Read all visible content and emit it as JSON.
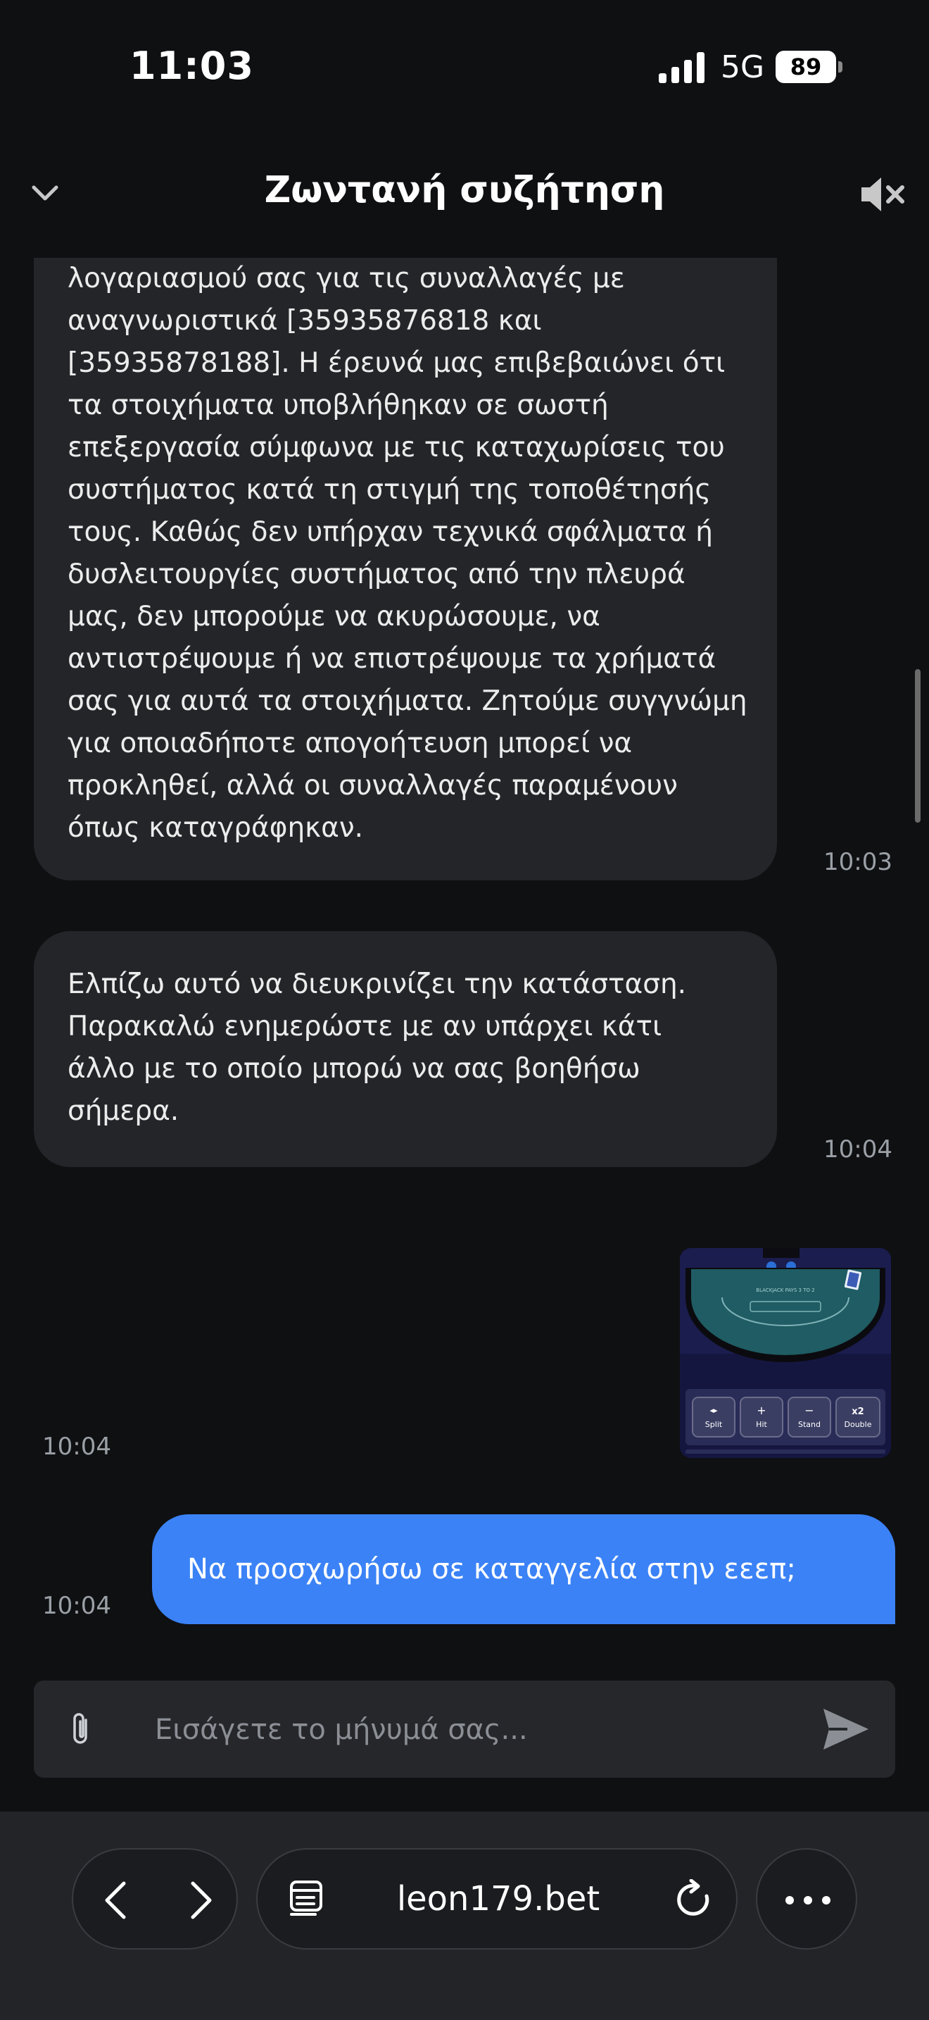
{
  "status_bar": {
    "time": "11:03",
    "network": "5G",
    "battery": "89"
  },
  "header": {
    "title": "Ζωντανή συζήτηση"
  },
  "messages": {
    "m1_lines": [
      "λογαριασμού σας για τις συναλλαγές με",
      "αναγνωριστικά [35935876818 και",
      "[35935878188]. Η έρευνά μας επιβεβαιώνει ότι",
      "τα στοιχήματα υποβλήθηκαν σε σωστή",
      "επεξεργασία σύμφωνα με τις καταχωρίσεις του",
      "συστήματος κατά τη στιγμή της τοποθέτησής",
      "τους. Καθώς δεν υπήρχαν τεχνικά σφάλματα ή",
      "δυσλειτουργίες συστήματος από την πλευρά",
      "μας, δεν μπορούμε να ακυρώσουμε, να",
      "αντιστρέψουμε ή να επιστρέψουμε τα χρήματά",
      "σας για αυτά τα στοιχήματα. Ζητούμε συγγνώμη",
      "για οποιαδήποτε απογοήτευση μπορεί να",
      "προκληθεί, αλλά οι συναλλαγές παραμένουν",
      "όπως καταγράφηκαν."
    ],
    "m1_time": "10:03",
    "m2_lines": [
      "Ελπίζω αυτό να διευκρινίζει την κατάσταση.",
      "Παρακαλώ ενημερώστε με αν υπάρχει κάτι",
      "άλλο με το οποίο μπορώ να σας βοηθήσω",
      "σήμερα."
    ],
    "m2_time": "10:04",
    "img_time": "10:04",
    "img_buttons": [
      "Split",
      "Hit",
      "Stand",
      "Double"
    ],
    "img_button_symbols": [
      "◂▸",
      "+",
      "−",
      "x2"
    ],
    "out_text": "Να προσχωρήσω σε καταγγελία στην εεεπ;",
    "out_time": "10:04"
  },
  "composer": {
    "placeholder": "Εισάγετε το μήνυμά σας..."
  },
  "browser": {
    "url": "leon179.bet"
  },
  "colors": {
    "background": "#0f1012",
    "incoming_bubble": "#232529",
    "outgoing_bubble": "#3b82f6",
    "table_green": "#1f5c63"
  }
}
